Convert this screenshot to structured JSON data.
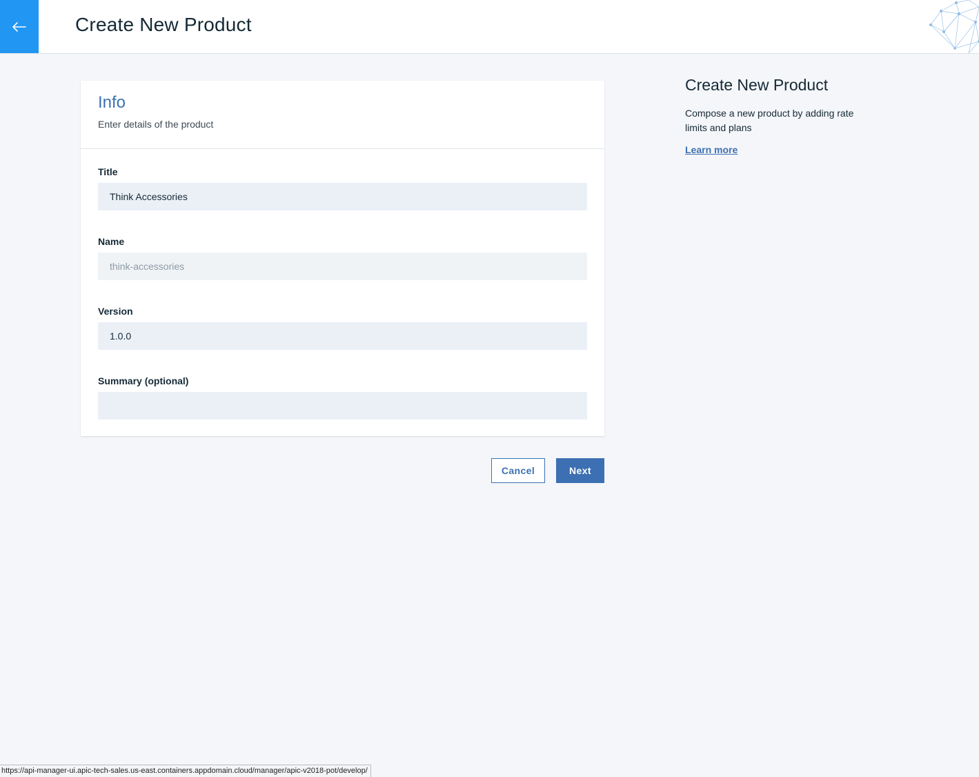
{
  "header": {
    "back_icon": "arrow-left-icon",
    "title": "Create New Product",
    "accent_color": "#2196f3"
  },
  "card": {
    "heading": "Info",
    "subheading": "Enter details of the product",
    "fields": {
      "title": {
        "label": "Title",
        "value": "Think Accessories"
      },
      "name": {
        "label": "Name",
        "value": "think-accessories"
      },
      "version": {
        "label": "Version",
        "value": "1.0.0"
      },
      "summary": {
        "label": "Summary (optional)",
        "value": ""
      }
    }
  },
  "actions": {
    "cancel_label": "Cancel",
    "next_label": "Next",
    "primary_color": "#3d70b2"
  },
  "sidebar": {
    "title": "Create New Product",
    "description": "Compose a new product by adding rate limits and plans",
    "link_label": "Learn more"
  },
  "status_bar": {
    "url": "https://api-manager-ui.apic-tech-sales.us-east.containers.appdomain.cloud/manager/apic-v2018-pot/develop/"
  }
}
